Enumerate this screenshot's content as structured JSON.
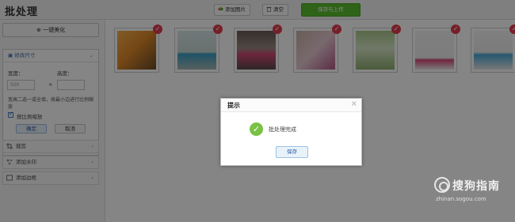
{
  "app": {
    "title": "批处理"
  },
  "toolbar": {
    "add_images_label": "添加图片",
    "clear_label": "清空",
    "save_upload_label": "保存与上传"
  },
  "sidebar": {
    "beautify_label": "一键美化",
    "resize": {
      "header": "修改尺寸",
      "width_label": "宽度：",
      "height_label": "高度：",
      "width_value": "500",
      "times": "×",
      "hint": "宽高二选一或全填，按最小边进行比例缩放",
      "keep_ratio_label": "按比例缩放",
      "confirm_label": "确定",
      "cancel_label": "取消"
    },
    "items": [
      {
        "label": "裁剪",
        "icon": "crop-icon"
      },
      {
        "label": "添加水印",
        "icon": "watermark-icon"
      },
      {
        "label": "添加边框",
        "icon": "border-icon"
      }
    ]
  },
  "gallery": {
    "count": 7,
    "selected_count": 7
  },
  "dialog": {
    "title": "提示",
    "close_symbol": "×",
    "message": "批处理完成",
    "button_label": "保存"
  },
  "watermark": {
    "brand": "搜狗指南",
    "url": "zhinan.sogou.com"
  },
  "colors": {
    "accent_green": "#5bbf2f",
    "check_red": "#e23c4e",
    "success_green": "#7bc144"
  }
}
